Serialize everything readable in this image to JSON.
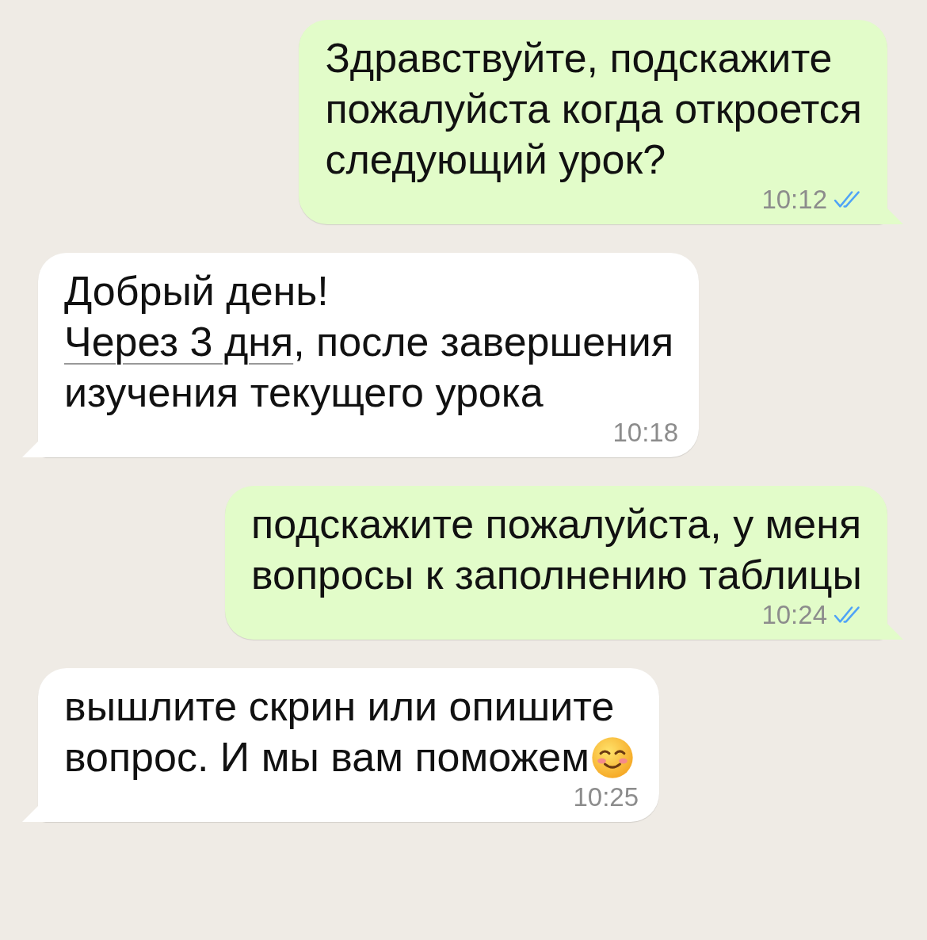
{
  "messages": [
    {
      "kind": "outgoing",
      "parts": [
        {
          "text": "Здравствуйте, подскажите\nпожалуйста когда откроется\nследующий урок?"
        }
      ],
      "time": "10:12",
      "read": true
    },
    {
      "kind": "incoming",
      "parts": [
        {
          "text": "Добрый день!\n"
        },
        {
          "text": "Через 3 дня",
          "link": true
        },
        {
          "text": ", после завершения\nизучения текущего урока"
        }
      ],
      "time": "10:18"
    },
    {
      "kind": "outgoing",
      "parts": [
        {
          "text": "подскажите пожалуйста, у меня\nвопросы к заполнению таблицы"
        }
      ],
      "time": "10:24",
      "read": true
    },
    {
      "kind": "incoming",
      "parts": [
        {
          "text": "вышлите скрин или опишите\nвопрос. И мы вам поможем"
        }
      ],
      "emoji": true,
      "time": "10:25"
    }
  ]
}
